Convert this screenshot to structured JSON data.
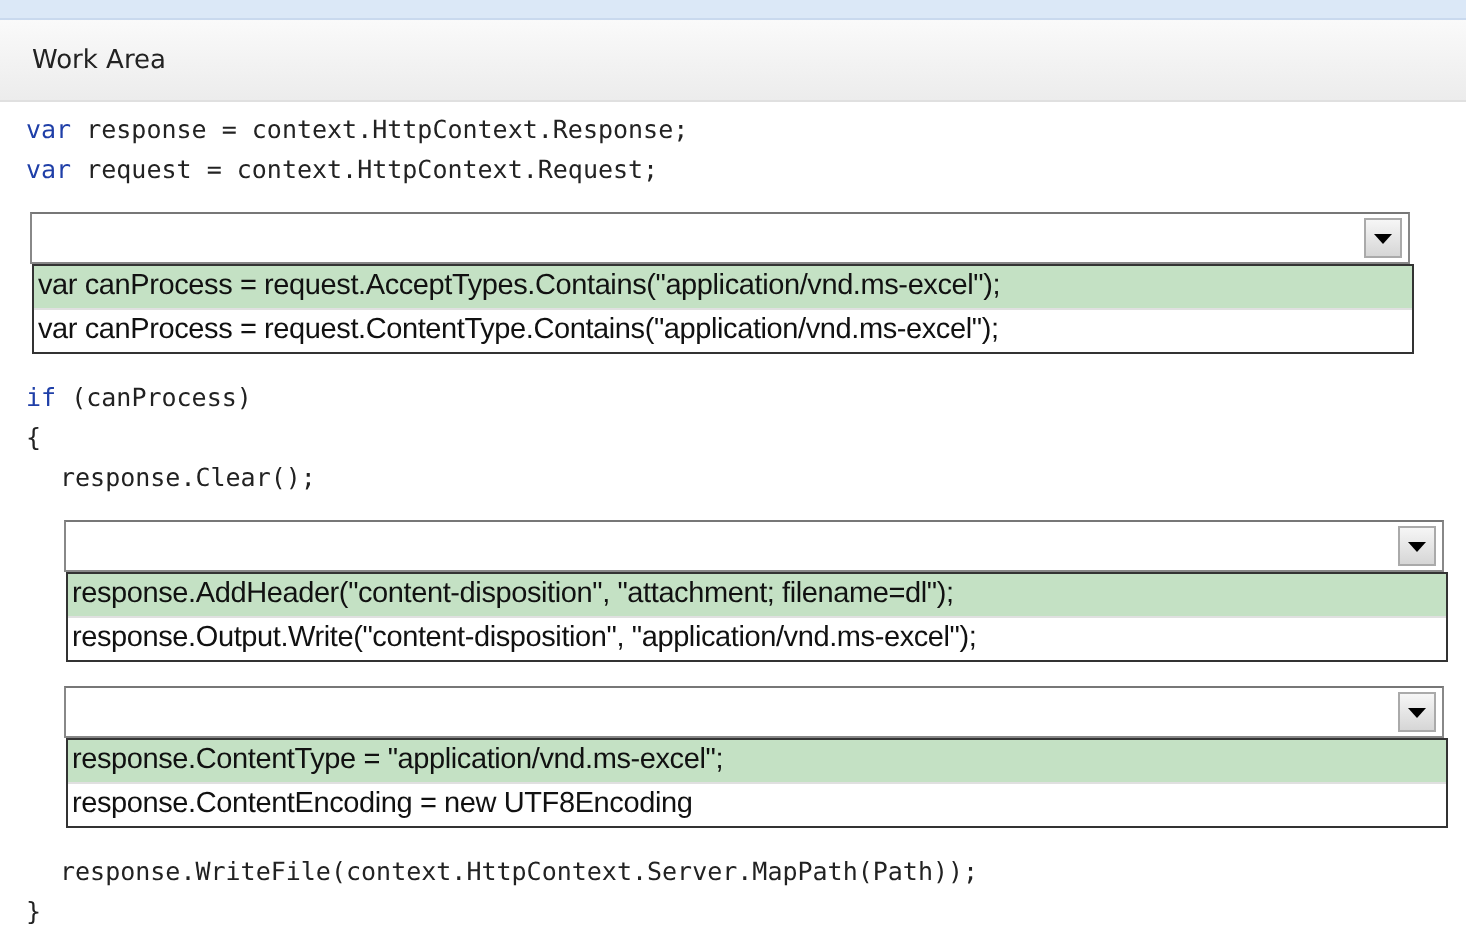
{
  "header": {
    "title": "Work Area"
  },
  "code": [
    {
      "kind": "line",
      "keyword": "var",
      "text": "response = context.HttpContext.Response;"
    },
    {
      "kind": "line",
      "keyword": "var",
      "text": "request = context.HttpContext.Request;"
    },
    {
      "kind": "dropdown",
      "options": [
        {
          "text": "var canProcess = request.AcceptTypes.Contains(\"application/vnd.ms-excel\");",
          "selected": true
        },
        {
          "text": "var canProcess = request.ContentType.Contains(\"application/vnd.ms-excel\");",
          "selected": false
        }
      ]
    },
    {
      "kind": "line",
      "keyword": "if",
      "text": "(canProcess)"
    },
    {
      "kind": "line",
      "text": "{"
    },
    {
      "kind": "block",
      "children": [
        {
          "kind": "line",
          "text": "response.Clear();"
        },
        {
          "kind": "dropdown",
          "options": [
            {
              "text": "response.AddHeader(\"content-disposition\", \"attachment; filename=dl\");",
              "selected": true
            },
            {
              "text": "response.Output.Write(\"content-disposition\", \"application/vnd.ms-excel\");",
              "selected": false
            }
          ]
        },
        {
          "kind": "dropdown",
          "options": [
            {
              "text": "response.ContentType = \"application/vnd.ms-excel\";",
              "selected": true
            },
            {
              "text": "response.ContentEncoding = new UTF8Encoding",
              "selected": false
            }
          ]
        },
        {
          "kind": "line",
          "text": "response.WriteFile(context.HttpContext.Server.MapPath(Path));"
        }
      ]
    },
    {
      "kind": "line",
      "text": "}"
    }
  ]
}
